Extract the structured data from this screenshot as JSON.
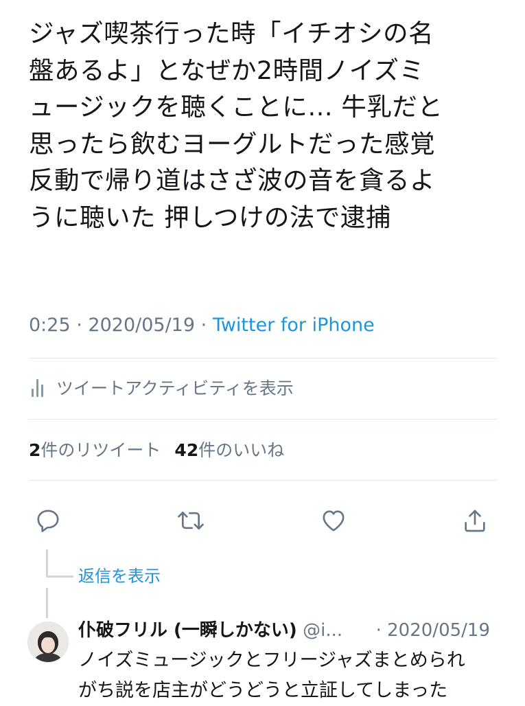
{
  "tweet": {
    "text_lines": [
      "ジャズ喫茶行った時「イチオシの名",
      "盤あるよ」となぜか2時間ノイズミ",
      "ュージックを聴くことに… 牛乳だと",
      "思ったら飲むヨーグルトだった感覚",
      "反動で帰り道はさざ波の音を貪るよ",
      "うに聴いた 押しつけの法で逮捕"
    ],
    "time": "0:25",
    "separator": "·",
    "date": "2020/05/19",
    "source": "Twitter for iPhone"
  },
  "activity": {
    "icon": "bar-chart-icon",
    "label": "ツイートアクティビティを表示"
  },
  "stats": {
    "retweet_count": "2",
    "retweet_label": "件のリツイート",
    "like_count": "42",
    "like_label": "件のいいね"
  },
  "actions": [
    {
      "name": "reply",
      "icon": "reply-icon"
    },
    {
      "name": "retweet",
      "icon": "retweet-icon"
    },
    {
      "name": "like",
      "icon": "heart-icon"
    },
    {
      "name": "share",
      "icon": "share-icon"
    }
  ],
  "thread": {
    "show_replies_label": "返信を表示"
  },
  "reply": {
    "name": "仆破フリル (一瞬しかない)",
    "handle": "@i...",
    "date": "· 2020/05/19",
    "text_lines": [
      "ノイズミュージックとフリージャズまとめられ",
      "がち説を店主がどうどうと立証してしまった"
    ]
  },
  "colors": {
    "text": "#14171a",
    "secondary": "#657786",
    "accent": "#1b95e0",
    "divider": "#e1e8ed",
    "icon": "#657786"
  }
}
